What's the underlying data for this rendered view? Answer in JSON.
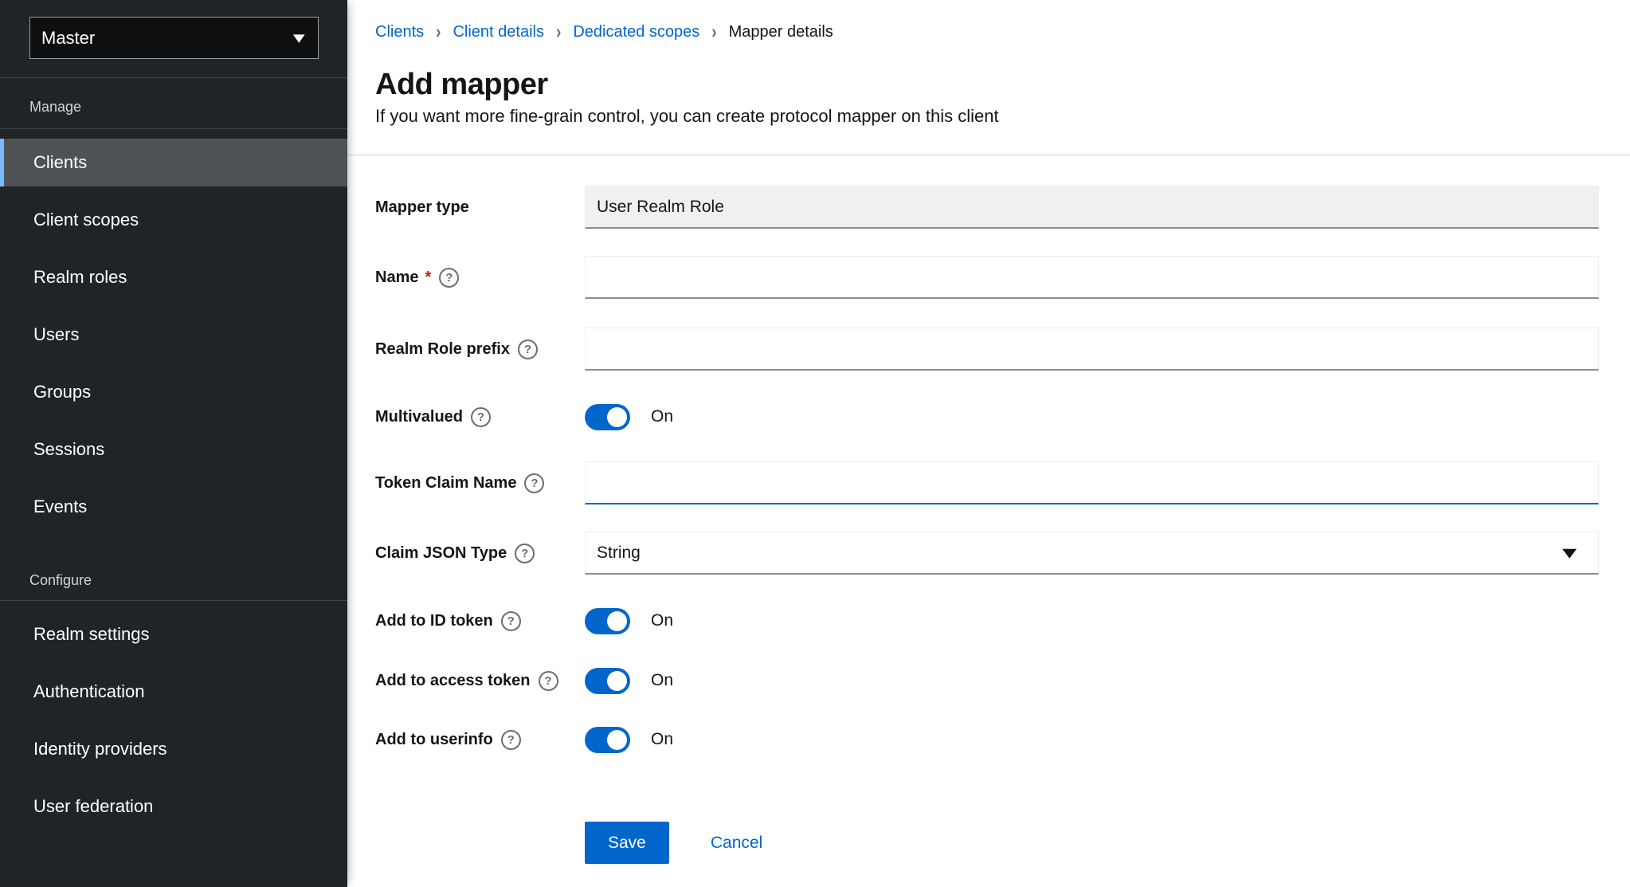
{
  "colors": {
    "accent": "#0066cc",
    "sidebar_bg": "#212427",
    "nav_selected_bg": "#4f5255",
    "nav_selected_bar": "#73bcf7",
    "readonly_field_bg": "#f0f0f0",
    "field_bottom_border": "#8a8d90",
    "required_red": "#c9190b"
  },
  "sidebar": {
    "realm_selector": {
      "value": "Master",
      "caret_icon": "chevron-down"
    },
    "sections": [
      {
        "title": "Manage",
        "items": [
          "Clients",
          "Client scopes",
          "Realm roles",
          "Users",
          "Groups",
          "Sessions",
          "Events"
        ],
        "selected": "Clients"
      },
      {
        "title": "Configure",
        "items": [
          "Realm settings",
          "Authentication",
          "Identity providers",
          "User federation"
        ]
      }
    ]
  },
  "breadcrumb": {
    "links": [
      "Clients",
      "Client details",
      "Dedicated scopes"
    ],
    "current": "Mapper details",
    "separator": "›"
  },
  "header": {
    "title": "Add mapper",
    "subtitle": "If you want more fine-grain control, you can create protocol mapper on this client"
  },
  "form": {
    "mapper_type": {
      "label": "Mapper type",
      "value": "User Realm Role"
    },
    "name": {
      "label": "Name",
      "required_mark": "*",
      "help_icon": "?",
      "value": ""
    },
    "realm_role_prefix": {
      "label": "Realm Role prefix",
      "help_icon": "?",
      "value": ""
    },
    "multivalued": {
      "label": "Multivalued",
      "help_icon": "?",
      "state_label": "On",
      "on": true
    },
    "token_claim_name": {
      "label": "Token Claim Name",
      "help_icon": "?",
      "value": "",
      "focused": true
    },
    "claim_json_type": {
      "label": "Claim JSON Type",
      "help_icon": "?",
      "value": "String"
    },
    "add_to_id_token": {
      "label": "Add to ID token",
      "help_icon": "?",
      "state_label": "On",
      "on": true
    },
    "add_to_access_token": {
      "label": "Add to access token",
      "help_icon": "?",
      "state_label": "On",
      "on": true
    },
    "add_to_userinfo": {
      "label": "Add to userinfo",
      "help_icon": "?",
      "state_label": "On",
      "on": true
    },
    "actions": {
      "save": "Save",
      "cancel": "Cancel"
    }
  }
}
